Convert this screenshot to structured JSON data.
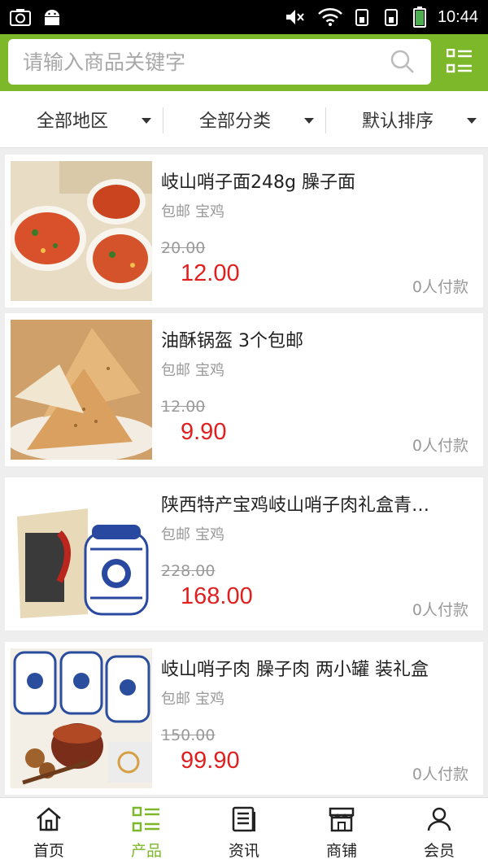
{
  "status_bar": {
    "time": "10:44"
  },
  "search": {
    "placeholder": "请输入商品关键字"
  },
  "filters": [
    {
      "label": "全部地区"
    },
    {
      "label": "全部分类"
    },
    {
      "label": "默认排序"
    }
  ],
  "products": [
    {
      "title": "岐山哨子面248g 臊子面",
      "tags": [
        "包邮",
        "宝鸡"
      ],
      "old_price": "20.00",
      "price": "12.00",
      "sold": "0人付款",
      "image": "bowls-of-noodle-soup"
    },
    {
      "title": "油酥锅盔 3个包邮",
      "tags": [
        "包邮",
        "宝鸡"
      ],
      "old_price": "12.00",
      "price": "9.90",
      "sold": "0人付款",
      "image": "flatbread-wedges"
    },
    {
      "title": "陕西特产宝鸡岐山哨子肉礼盒青…",
      "tags": [
        "包邮",
        "宝鸡"
      ],
      "old_price": "228.00",
      "price": "168.00",
      "sold": "0人付款",
      "image": "gift-box-and-porcelain-jar"
    },
    {
      "title": "岐山哨子肉 臊子肉 两小罐 装礼盒",
      "tags": [
        "包邮",
        "宝鸡"
      ],
      "old_price": "150.00",
      "price": "99.90",
      "sold": "0人付款",
      "image": "porcelain-jars-and-meat"
    }
  ],
  "bottom_nav": [
    {
      "label": "首页",
      "icon": "home-icon"
    },
    {
      "label": "产品",
      "icon": "list-icon",
      "active": true
    },
    {
      "label": "资讯",
      "icon": "news-icon"
    },
    {
      "label": "商铺",
      "icon": "store-icon"
    },
    {
      "label": "会员",
      "icon": "user-icon"
    }
  ],
  "colors": {
    "accent": "#7cb829",
    "price": "#e0201f"
  }
}
